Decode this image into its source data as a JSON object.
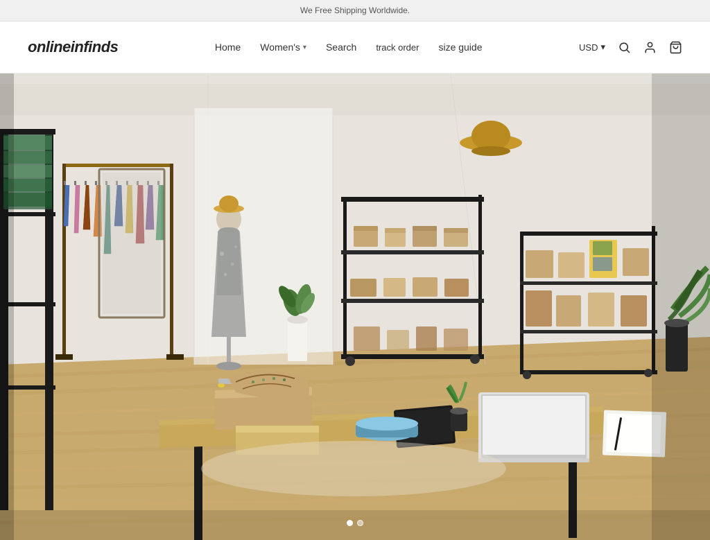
{
  "announcement": {
    "text": "We Free Shipping Worldwide."
  },
  "header": {
    "logo": "onlineinfinds",
    "nav": [
      {
        "label": "Home",
        "id": "home",
        "hasDropdown": false
      },
      {
        "label": "Women's",
        "id": "womens",
        "hasDropdown": true
      },
      {
        "label": "Search",
        "id": "search",
        "hasDropdown": false
      },
      {
        "label": "track order",
        "id": "track-order",
        "hasDropdown": false
      },
      {
        "label": "size guide",
        "id": "size-guide",
        "hasDropdown": false
      }
    ],
    "currency": {
      "label": "USD",
      "hasDropdown": true
    },
    "icons": [
      {
        "id": "search-icon",
        "symbol": "🔍"
      },
      {
        "id": "account-icon",
        "symbol": "👤"
      },
      {
        "id": "cart-icon",
        "symbol": "🛒"
      }
    ]
  },
  "hero": {
    "slide_count": 2,
    "active_slide": 1
  }
}
